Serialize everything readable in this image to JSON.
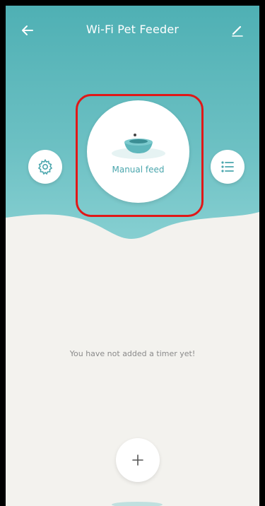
{
  "header": {
    "title": "Wi-Fi Pet Feeder"
  },
  "feed": {
    "label": "Manual feed"
  },
  "timers": {
    "empty_message": "You have not added a timer yet!"
  },
  "icons": {
    "back": "arrow-left-icon",
    "edit": "pencil-icon",
    "settings": "gear-icon",
    "list": "list-icon",
    "bowl": "pet-bowl-icon",
    "add": "plus-icon"
  },
  "colors": {
    "header_top": "#4fb0b4",
    "header_bottom": "#7cc9cc",
    "accent_text": "#4aa6ad",
    "content_bg": "#f3f2ee",
    "highlight": "#e01818"
  }
}
